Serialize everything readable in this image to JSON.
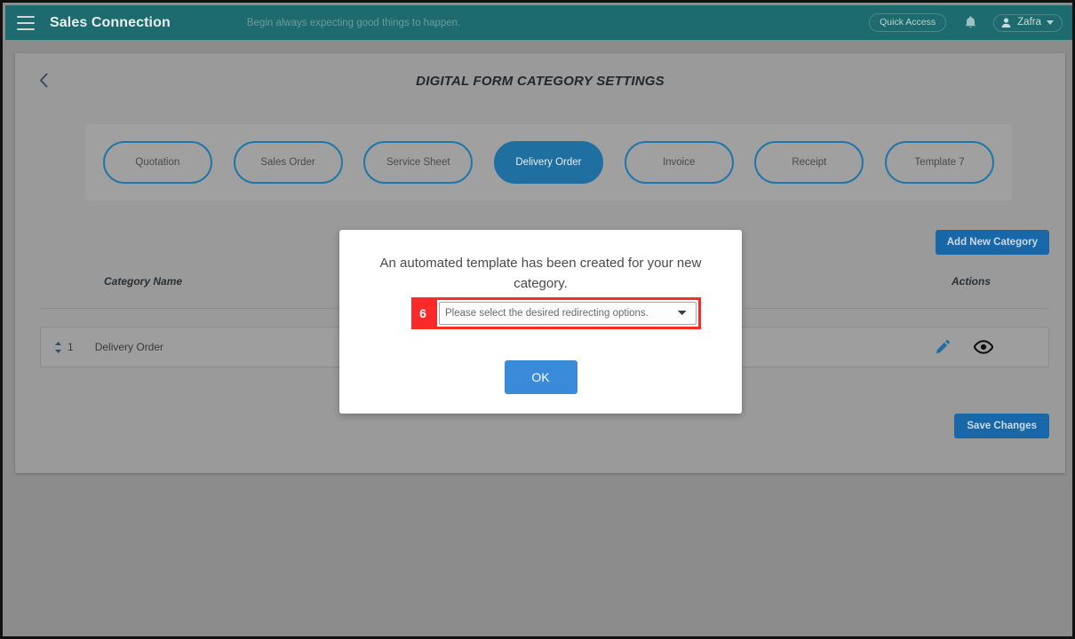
{
  "topbar": {
    "menu_icon": "hamburger-icon",
    "brand": "Sales Connection",
    "tagline": "Begin always expecting good things to happen.",
    "quick_access_label": "Quick Access",
    "notification_icon": "bell-icon",
    "user_icon": "user-avatar-icon",
    "user_name": "Zafra",
    "user_caret_icon": "chevron-down-icon",
    "background_color": "#1d6b6e"
  },
  "page": {
    "back_icon": "chevron-left-icon",
    "title": "DIGITAL FORM CATEGORY SETTINGS",
    "background_color": "#9a9a9a"
  },
  "tabs": [
    {
      "label": "Quotation",
      "active": false
    },
    {
      "label": "Sales Order",
      "active": false
    },
    {
      "label": "Service Sheet",
      "active": false
    },
    {
      "label": "Delivery Order",
      "active": true
    },
    {
      "label": "Invoice",
      "active": false
    },
    {
      "label": "Receipt",
      "active": false
    },
    {
      "label": "Template 7",
      "active": false
    }
  ],
  "toolbar": {
    "add_new_category_label": "Add New Category",
    "save_changes_label": "Save Changes",
    "primary_color": "#1867a8"
  },
  "table": {
    "columns": {
      "category_name": "Category Name",
      "actions": "Actions"
    },
    "rows": [
      {
        "drag_icon": "sort-handle-icon",
        "index": "1",
        "category_name": "Delivery Order",
        "edit_icon": "pencil-icon",
        "view_icon": "eye-icon"
      }
    ]
  },
  "modal": {
    "message": "An automated template has been created for your new category.",
    "step_badge": "6",
    "select": {
      "placeholder": "Please select the desired redirecting options.",
      "selected": "Please select the desired redirecting options.",
      "chevron_icon": "chevron-down-icon",
      "options": [
        "Please select the desired redirecting options."
      ]
    },
    "ok_label": "OK",
    "ok_color": "#3a8ada",
    "highlight_color": "#fb2a2a"
  }
}
